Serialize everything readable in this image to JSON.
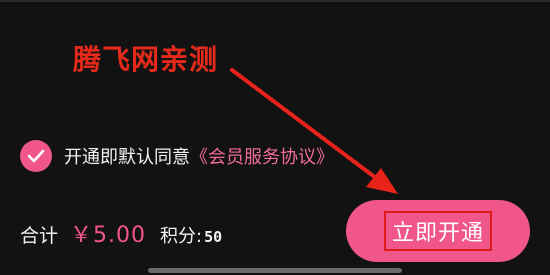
{
  "watermark": {
    "text": "腾飞网亲测"
  },
  "agreement": {
    "checked": true,
    "text": "开通即默认同意",
    "link_text": "《会员服务协议》"
  },
  "total": {
    "label": "合计",
    "price": "￥5.00",
    "points_label": "积分:",
    "points_value": "50"
  },
  "open_button": {
    "label": "立即开通"
  },
  "colors": {
    "background": "#121212",
    "accent_pink": "#f0568a",
    "link_pink": "#f26c9c",
    "watermark_red": "#e52a1c",
    "highlight_red": "#e01b1b",
    "arrow_red": "#e8231a"
  },
  "icons": {
    "check": "checkmark-icon",
    "annotation": "red-arrow-icon"
  }
}
